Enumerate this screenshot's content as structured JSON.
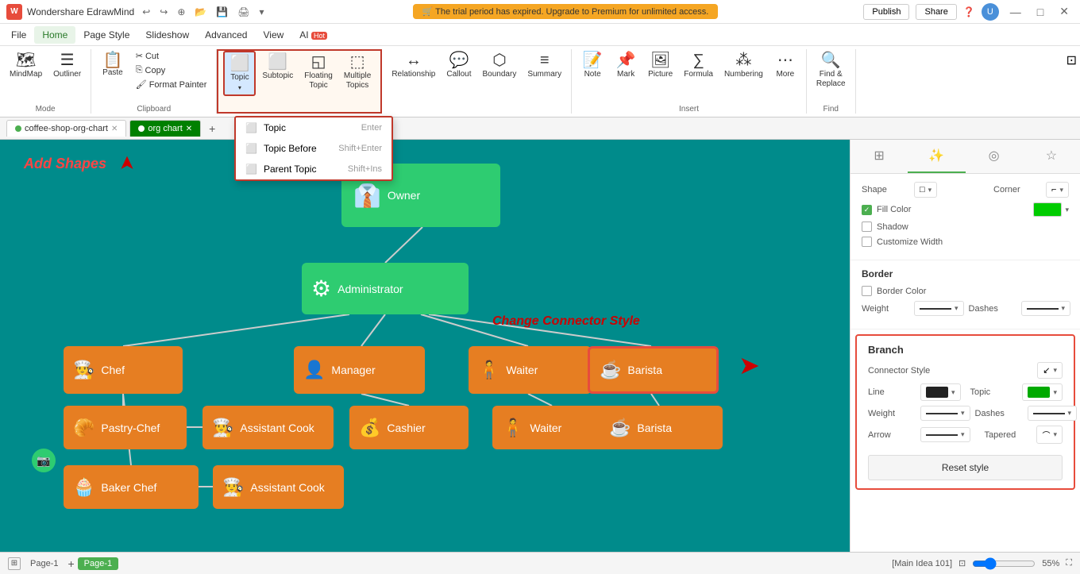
{
  "app": {
    "title": "Wondershare EdrawMind",
    "logo": "W",
    "trial_notice": "🛒 The trial period has expired. Upgrade to Premium for unlimited access.",
    "publish_label": "Publish",
    "share_label": "Share"
  },
  "titlebar": {
    "undo_icon": "↩",
    "redo_icon": "↪",
    "new_icon": "⊕",
    "open_icon": "📂",
    "save_icon": "💾",
    "print_icon": "🖨",
    "more_icon": "▾",
    "minimize": "—",
    "maximize": "□",
    "close": "✕"
  },
  "menubar": {
    "items": [
      "File",
      "Home",
      "Page Style",
      "Slideshow",
      "Advanced",
      "View",
      "AI 🔥"
    ]
  },
  "ribbon": {
    "mode_group_label": "Mode",
    "mindmap_label": "MindMap",
    "outliner_label": "Outliner",
    "clipboard_group_label": "Clipboard",
    "paste_label": "Paste",
    "cut_label": "Cut",
    "copy_label": "Copy",
    "format_painter_label": "Format\nPainter",
    "topic_group_label": "",
    "topic_label": "Topic",
    "subtopic_label": "Subtopic",
    "floating_topic_label": "Floating\nTopic",
    "multiple_topics_label": "Multiple\nTopics",
    "relationship_label": "Relationship",
    "callout_label": "Callout",
    "boundary_label": "Boundary",
    "summary_label": "Summary",
    "insert_group_label": "Insert",
    "note_label": "Note",
    "mark_label": "Mark",
    "picture_label": "Picture",
    "formula_label": "Formula",
    "numbering_label": "Numbering",
    "more_label": "More",
    "find_replace_label": "Find &\nReplace",
    "find_group_label": "Find"
  },
  "topic_dropdown": {
    "items": [
      {
        "label": "Topic",
        "shortcut": "Enter"
      },
      {
        "label": "Topic Before",
        "shortcut": "Shift+Enter"
      },
      {
        "label": "Parent Topic",
        "shortcut": "Shift+Ins"
      }
    ]
  },
  "tabs": {
    "items": [
      {
        "label": "coffee-shop-org-chart",
        "active": false,
        "dot_color": "#4CAF50"
      },
      {
        "label": "org chart",
        "active": true,
        "dot_color": "#4CAF50"
      }
    ],
    "add_label": "+"
  },
  "canvas": {
    "add_shapes_label": "Add Shapes",
    "change_connector_label": "Change Connector Style",
    "nodes": {
      "owner": "Owner",
      "administrator": "Administrator",
      "chef": "Chef",
      "manager": "Manager",
      "waiter1": "Waiter",
      "barista1": "Barista",
      "pastry_chef": "Pastry-Chef",
      "assistant_cook1": "Assistant Cook",
      "cashier": "Cashier",
      "waiter2": "Waiter",
      "barista2": "Barista",
      "baker_chef": "Baker Chef",
      "assistant_cook2": "Assistant Cook"
    }
  },
  "right_panel": {
    "tabs": [
      "⊞",
      "✨",
      "◎",
      "☆"
    ],
    "shape_label": "Shape",
    "corner_label": "Corner",
    "fill_color_label": "Fill Color",
    "fill_color": "#00cc00",
    "shadow_label": "Shadow",
    "customize_width_label": "Customize Width",
    "border_section_label": "Border",
    "border_color_label": "Border Color",
    "weight_label": "Weight",
    "dashes_label": "Dashes",
    "branch_section_label": "Branch",
    "connector_style_label": "Connector Style",
    "line_label": "Line",
    "line_color": "#222222",
    "topic_label": "Topic",
    "topic_color": "#00aa00",
    "weight2_label": "Weight",
    "dashes2_label": "Dashes",
    "arrow_label": "Arrow",
    "tapered_label": "Tapered",
    "reset_style_label": "Reset style"
  },
  "statusbar": {
    "page_label": "Page-1",
    "add_page": "+",
    "active_page": "Page-1",
    "info": "[Main Idea 101]",
    "zoom_level": "55%",
    "fit_icon": "⊡",
    "fullscreen_icon": "⛶"
  }
}
